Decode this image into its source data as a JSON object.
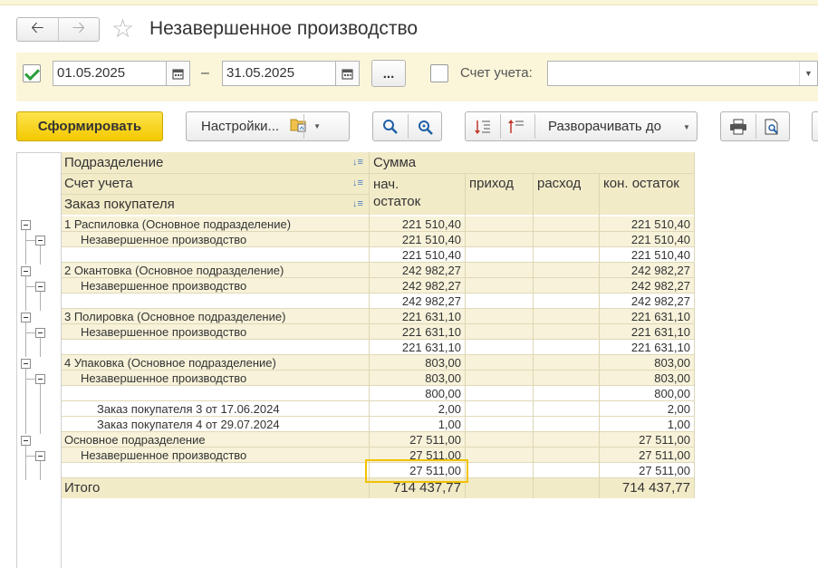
{
  "window": {
    "title": "Незавершенное производство",
    "back_icon": "arrow-left-icon",
    "forward_icon": "arrow-right-icon"
  },
  "filter": {
    "period_enabled": true,
    "date_from": "01.05.2025",
    "date_to": "31.05.2025",
    "dash": "–",
    "period_button": "...",
    "account_enabled": false,
    "account_label": "Счет учета:",
    "account_value": ""
  },
  "toolbar": {
    "generate": "Сформировать",
    "settings": "Настройки...",
    "expand_to": "Разворачивать до"
  },
  "report": {
    "headers": {
      "division": "Подразделение",
      "account": "Счет учета",
      "order": "Заказ покупателя",
      "sum": "Сумма",
      "start": "нач.\nостаток",
      "income": "приход",
      "expense": "расход",
      "end": "кон. остаток"
    },
    "rows": [
      {
        "label": "1 Распиловка (Основное подразделение)",
        "level": 0,
        "start": "221 510,40",
        "end": "221 510,40"
      },
      {
        "label": "Незавершенное производство",
        "level": 1,
        "start": "221 510,40",
        "end": "221 510,40"
      },
      {
        "label": "",
        "level": 2,
        "start": "221 510,40",
        "end": "221 510,40"
      },
      {
        "label": "2 Окантовка (Основное подразделение)",
        "level": 0,
        "start": "242 982,27",
        "end": "242 982,27"
      },
      {
        "label": "Незавершенное производство",
        "level": 1,
        "start": "242 982,27",
        "end": "242 982,27"
      },
      {
        "label": "",
        "level": 2,
        "start": "242 982,27",
        "end": "242 982,27"
      },
      {
        "label": "3 Полировка (Основное подразделение)",
        "level": 0,
        "start": "221 631,10",
        "end": "221 631,10"
      },
      {
        "label": "Незавершенное производство",
        "level": 1,
        "start": "221 631,10",
        "end": "221 631,10"
      },
      {
        "label": "",
        "level": 2,
        "start": "221 631,10",
        "end": "221 631,10"
      },
      {
        "label": "4 Упаковка (Основное подразделение)",
        "level": 0,
        "start": "803,00",
        "end": "803,00"
      },
      {
        "label": "Незавершенное производство",
        "level": 1,
        "start": "803,00",
        "end": "803,00"
      },
      {
        "label": "",
        "level": 2,
        "start": "800,00",
        "end": "800,00"
      },
      {
        "label": "Заказ покупателя 3 от 17.06.2024",
        "level": 2,
        "start": "2,00",
        "end": "2,00"
      },
      {
        "label": "Заказ покупателя 4 от 29.07.2024",
        "level": 2,
        "start": "1,00",
        "end": "1,00"
      },
      {
        "label": "Основное подразделение",
        "level": 0,
        "start": "27 511,00",
        "end": "27 511,00"
      },
      {
        "label": "Незавершенное производство",
        "level": 1,
        "start": "27 511,00",
        "end": "27 511,00"
      },
      {
        "label": "",
        "level": 2,
        "start": "27 511,00",
        "end": "27 511,00"
      }
    ],
    "total": {
      "label": "Итого",
      "start": "714 437,77",
      "end": "714 437,77"
    }
  }
}
